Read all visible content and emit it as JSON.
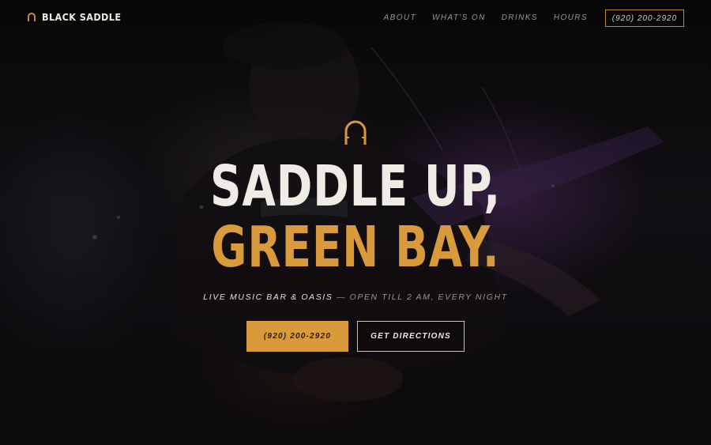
{
  "brand": {
    "name": "BLACK SADDLE",
    "icon": "horseshoe-icon"
  },
  "nav": {
    "links": [
      "ABOUT",
      "WHAT'S ON",
      "DRINKS",
      "HOURS"
    ],
    "phone": "(920) 200-2920"
  },
  "hero": {
    "icon": "horseshoe-icon",
    "headline_1": "SADDLE UP,",
    "headline_2": "GREEN BAY.",
    "tagline_main": "LIVE MUSIC BAR & OASIS",
    "tagline_rest": " — OPEN TILL 2 AM, EVERY NIGHT",
    "call_button": "(920) 200-2920",
    "directions_button": "GET DIRECTIONS"
  },
  "colors": {
    "accent": "#d99a3c",
    "background": "#0d0b0d",
    "text_light": "#efece6",
    "text_muted": "#9c958e"
  }
}
